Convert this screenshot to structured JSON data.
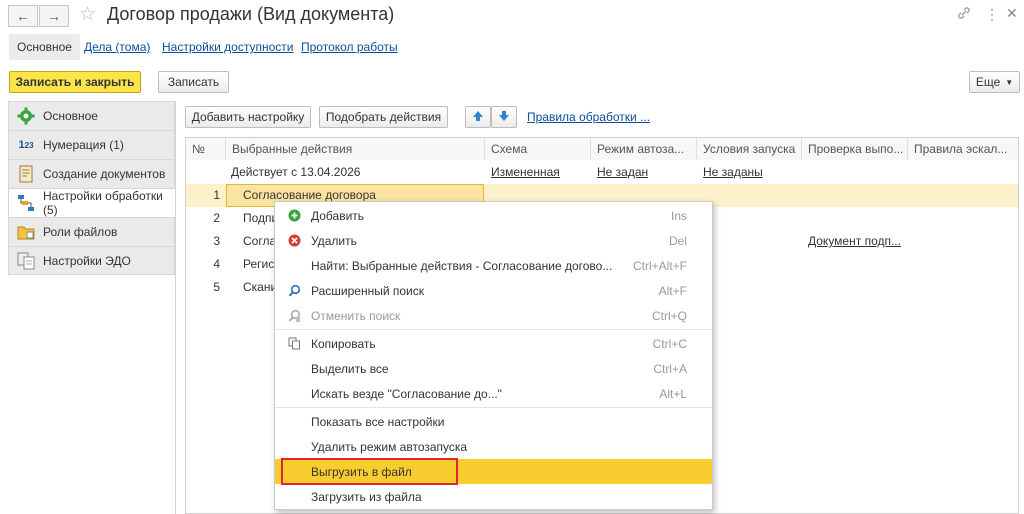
{
  "window": {
    "title": "Договор продажи (Вид документа)",
    "back_icon": "arrow-left",
    "forward_icon": "arrow-right",
    "link_icon": "chain-link",
    "more_icon": "vertical-dots",
    "close_icon": "x"
  },
  "tabs": [
    {
      "label": "Основное",
      "active": true
    },
    {
      "label": "Дела (тома)"
    },
    {
      "label": "Настройки доступности"
    },
    {
      "label": "Протокол работы"
    }
  ],
  "toolbar": {
    "save_close": "Записать и закрыть",
    "save": "Записать",
    "more": "Еще"
  },
  "sidebar": {
    "items": [
      {
        "label": "Основное",
        "icon": "gear-icon"
      },
      {
        "label": "Нумерация (1)",
        "icon": "numbering-icon"
      },
      {
        "label": "Создание документов",
        "icon": "document-icon"
      },
      {
        "label": "Настройки обработки (5)",
        "icon": "workflow-icon",
        "active": true
      },
      {
        "label": "Роли файлов",
        "icon": "folder-icon"
      },
      {
        "label": "Настройки ЭДО",
        "icon": "edo-icon"
      }
    ]
  },
  "grid_toolbar": {
    "add": "Добавить настройку",
    "pick": "Подобрать действия",
    "rules_link": "Правила обработки ..."
  },
  "table": {
    "columns": [
      "№",
      "Выбранные действия",
      "Схема",
      "Режим автоза...",
      "Условия запуска",
      "Проверка выпо...",
      "Правила эскал..."
    ],
    "group_row": {
      "action": "Действует с 13.04.2026",
      "scheme": "Измененная",
      "mode": "Не задан",
      "conditions": "Не заданы"
    },
    "rows": [
      {
        "num": "1",
        "action": "Согласование договора"
      },
      {
        "num": "2",
        "action": "Подпи"
      },
      {
        "num": "3",
        "action": "Согла",
        "check": "Документ подп..."
      },
      {
        "num": "4",
        "action": "Регист"
      },
      {
        "num": "5",
        "action": "Скани"
      }
    ]
  },
  "context_menu": {
    "items": [
      {
        "label": "Добавить",
        "shortcut": "Ins",
        "icon": "plus-circle-icon"
      },
      {
        "label": "Удалить",
        "shortcut": "Del",
        "icon": "delete-circle-icon"
      },
      {
        "label": "Найти: Выбранные действия - Согласование догово...",
        "shortcut": "Ctrl+Alt+F"
      },
      {
        "label": "Расширенный поиск",
        "shortcut": "Alt+F",
        "icon": "search-icon"
      },
      {
        "label": "Отменить поиск",
        "shortcut": "Ctrl+Q",
        "icon": "cancel-search-icon",
        "disabled": true
      },
      {
        "label": "Копировать",
        "shortcut": "Ctrl+C",
        "icon": "copy-icon"
      },
      {
        "label": "Выделить все",
        "shortcut": "Ctrl+A"
      },
      {
        "label": "Искать везде \"Согласование до...\"",
        "shortcut": "Alt+L"
      },
      {
        "label": "Показать все настройки",
        "shortcut": ""
      },
      {
        "label": "Удалить режим автозапуска",
        "shortcut": ""
      },
      {
        "label": "Выгрузить в файл",
        "shortcut": "",
        "highlighted": true
      },
      {
        "label": "Загрузить из файла",
        "shortcut": ""
      }
    ]
  },
  "colors": {
    "accent_yellow": "#fde44a",
    "highlight": "#f9cd2f",
    "selected_row": "#fdf1c9",
    "link": "#0d4d99",
    "annotation_red": "#e3262b"
  }
}
